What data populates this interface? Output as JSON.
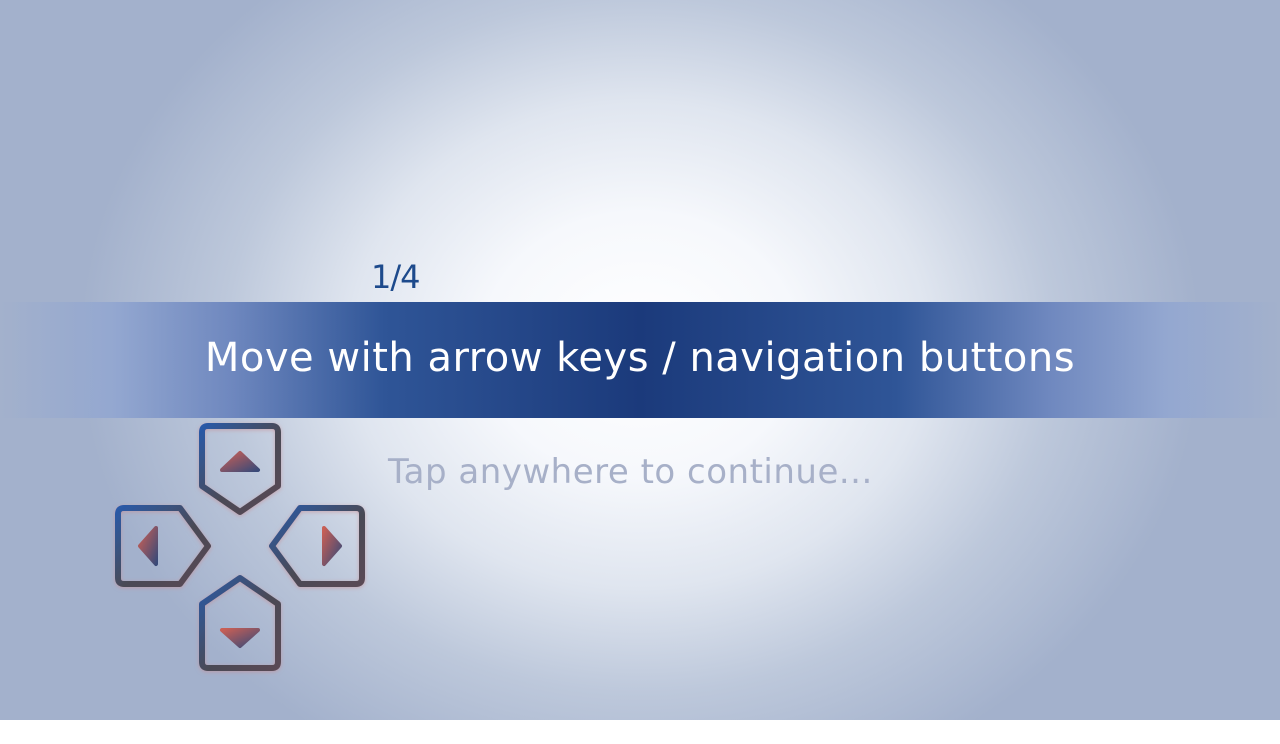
{
  "tutorial": {
    "step_counter": "1/4",
    "instruction": "Move with arrow keys / navigation buttons",
    "continue_hint": "Tap anywhere to continue..."
  },
  "dpad": {
    "keys": [
      "up-arrow-key",
      "left-arrow-key",
      "right-arrow-key",
      "down-arrow-key"
    ]
  },
  "colors": {
    "banner": "#1b3a7b",
    "step_counter": "#1d4a8c",
    "hint_text": "#a7b0c8",
    "key_outline_dark": "#4a4a52",
    "key_outline_blue": "#2a5aa8",
    "arrow_red": "#c25a55"
  }
}
